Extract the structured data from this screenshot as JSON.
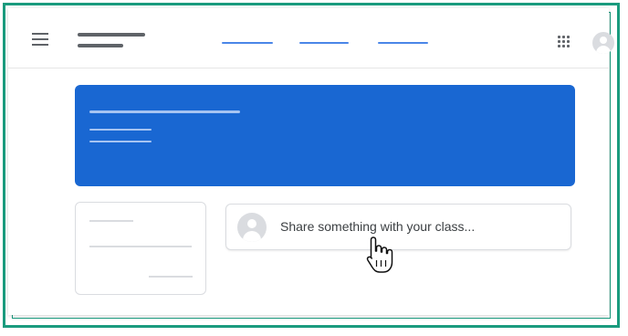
{
  "share": {
    "placeholder": "Share something with your class..."
  },
  "icons": {
    "menu": "hamburger-menu-icon",
    "apps": "apps-grid-icon",
    "account": "account-avatar-icon",
    "user": "user-avatar-icon",
    "pointer": "hand-pointer-cursor-icon"
  },
  "colors": {
    "border_accent": "#1a9b7e",
    "banner": "#1967d2",
    "tab_indicator": "#4a86e8"
  }
}
